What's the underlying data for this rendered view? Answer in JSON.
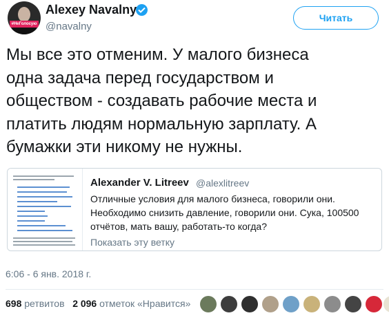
{
  "tweet": {
    "author": "Alexey Navalny",
    "handle": "@navalny",
    "follow_label": "Читать",
    "avatar_tag": "#НеГолосую",
    "text": "Мы все это отменим. У малого бизнеса\nодна задача перед государством и\nобществом - создавать рабочие места и\nплатить людям нормальную зарплату. А\nбумажки эти никому не нужны.",
    "timestamp": "6:06 - 6 янв. 2018 г."
  },
  "quoted": {
    "author": "Alexander V. Litreev",
    "handle": "@alexlitreev",
    "text": "Отличные условия для малого бизнеса, говорили они.\nНеобходимо снизить давление, говорили они. Сука, 100500\nотчётов, мать вашу, работать-то когда?",
    "show_thread": "Показать эту ветку"
  },
  "stats": {
    "retweets_count": "698",
    "retweets_label": "ретвитов",
    "likes_count": "2 096",
    "likes_label": "отметок «Нравится»"
  },
  "colors": {
    "accent": "#1da1f2",
    "text": "#14171a",
    "secondary": "#657786",
    "border": "#ccd6dd"
  },
  "likers": [
    "avatar-1",
    "avatar-2",
    "avatar-3",
    "avatar-4",
    "avatar-5",
    "avatar-6",
    "avatar-7",
    "avatar-8",
    "avatar-9",
    "avatar-10"
  ]
}
